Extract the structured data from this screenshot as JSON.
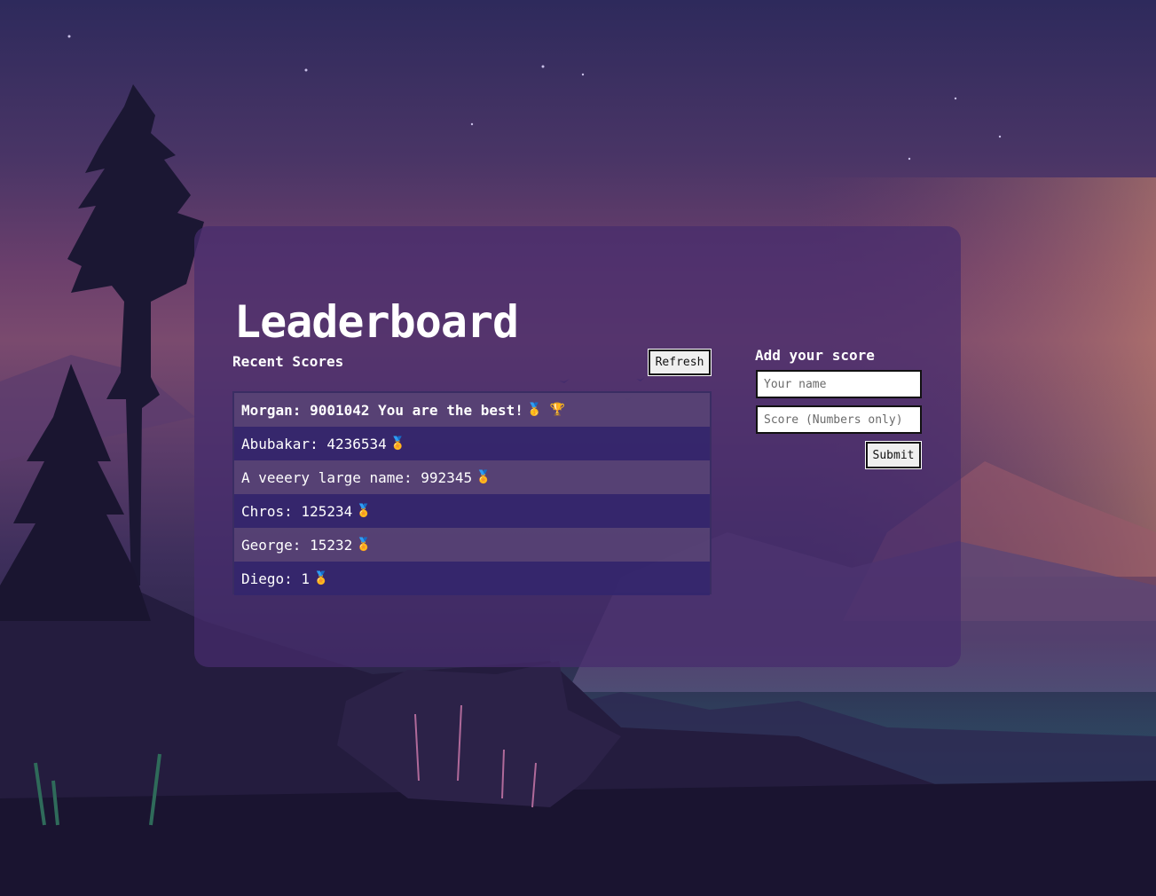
{
  "header": {
    "title": "Leaderboard"
  },
  "scores": {
    "section_title": "Recent Scores",
    "refresh_label": "Refresh",
    "entries": [
      {
        "text": "Morgan: 9001042 You are the best!",
        "badges": "🥇 🏆"
      },
      {
        "text": "Abubakar: 4236534",
        "badges": "🏅"
      },
      {
        "text": "A veeery large name: 992345",
        "badges": "🏅"
      },
      {
        "text": "Chros: 125234",
        "badges": "🏅"
      },
      {
        "text": "George: 15232",
        "badges": "🏅"
      },
      {
        "text": "Diego: 1",
        "badges": "🏅"
      }
    ]
  },
  "form": {
    "title": "Add your score",
    "name_placeholder": "Your name",
    "name_value": "",
    "score_placeholder": "Score (Numbers only)",
    "score_value": "",
    "submit_label": "Submit"
  },
  "colors": {
    "panel": "#462d6e",
    "row_light": "#584476",
    "row_dark": "#34266c",
    "text": "#ffffff"
  }
}
